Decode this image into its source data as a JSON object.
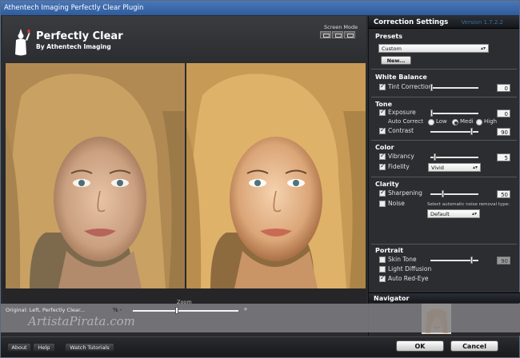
{
  "window": {
    "title": "Athentech Imaging Perfectly Clear Plugin"
  },
  "brand": {
    "name": "Perfectly Clear",
    "subtitle": "By Athentech Imaging"
  },
  "screen_mode": {
    "label": "Screen Mode"
  },
  "zoom": {
    "label": "Zoom",
    "minus": "% -",
    "plus": "+",
    "value_fraction": 0.42
  },
  "banner": {
    "caption": "Original: Left, Perfectly Clear...",
    "watermark": "ArtistaPirata.com"
  },
  "panel": {
    "title": "Correction Settings",
    "version": "Version 1.7.2.2",
    "presets": {
      "title": "Presets",
      "selected": "Custom",
      "new_button": "New..."
    },
    "white_balance": {
      "title": "White Balance",
      "tint": {
        "label": "Tint Correction",
        "checked": true,
        "value": "0",
        "level": 0.0
      }
    },
    "tone": {
      "title": "Tone",
      "exposure": {
        "label": "Exposure",
        "checked": true,
        "value": "0",
        "level": 0.0
      },
      "auto_correct": {
        "label": "Auto Correct",
        "options": [
          "Low",
          "Medi",
          "High"
        ],
        "selected": "Medi"
      },
      "contrast": {
        "label": "Contrast",
        "checked": true,
        "value": "90",
        "level": 0.9
      }
    },
    "color": {
      "title": "Color",
      "vibrancy": {
        "label": "Vibrancy",
        "checked": true,
        "value": "5",
        "level": 0.08
      },
      "fidelity": {
        "label": "Fidelity",
        "checked": true,
        "selected": "Vivid"
      }
    },
    "clarity": {
      "title": "Clarity",
      "sharpening": {
        "label": "Sharpening",
        "checked": true,
        "value": "50",
        "level": 0.25
      },
      "noise": {
        "label": "Noise",
        "checked": false,
        "hint": "Select automatic noise removal type:",
        "selected": "Default"
      }
    },
    "portrait": {
      "title": "Portrait",
      "skin_tone": {
        "label": "Skin Tone",
        "checked": false,
        "value": "90",
        "level": 0.9
      },
      "light_diffusion": {
        "label": "Light Diffusion",
        "checked": false
      },
      "auto_red_eye": {
        "label": "Auto Red-Eye",
        "checked": true
      }
    },
    "navigator": {
      "title": "Navigator"
    }
  },
  "footer": {
    "about": "About",
    "help": "Help",
    "tutorials": "Watch Tutorials",
    "ok": "OK",
    "cancel": "Cancel"
  },
  "colors": {
    "titlebar": "#3a6aae",
    "accent_version": "#3b6e9c",
    "panel_bg": "#2c2d30"
  }
}
